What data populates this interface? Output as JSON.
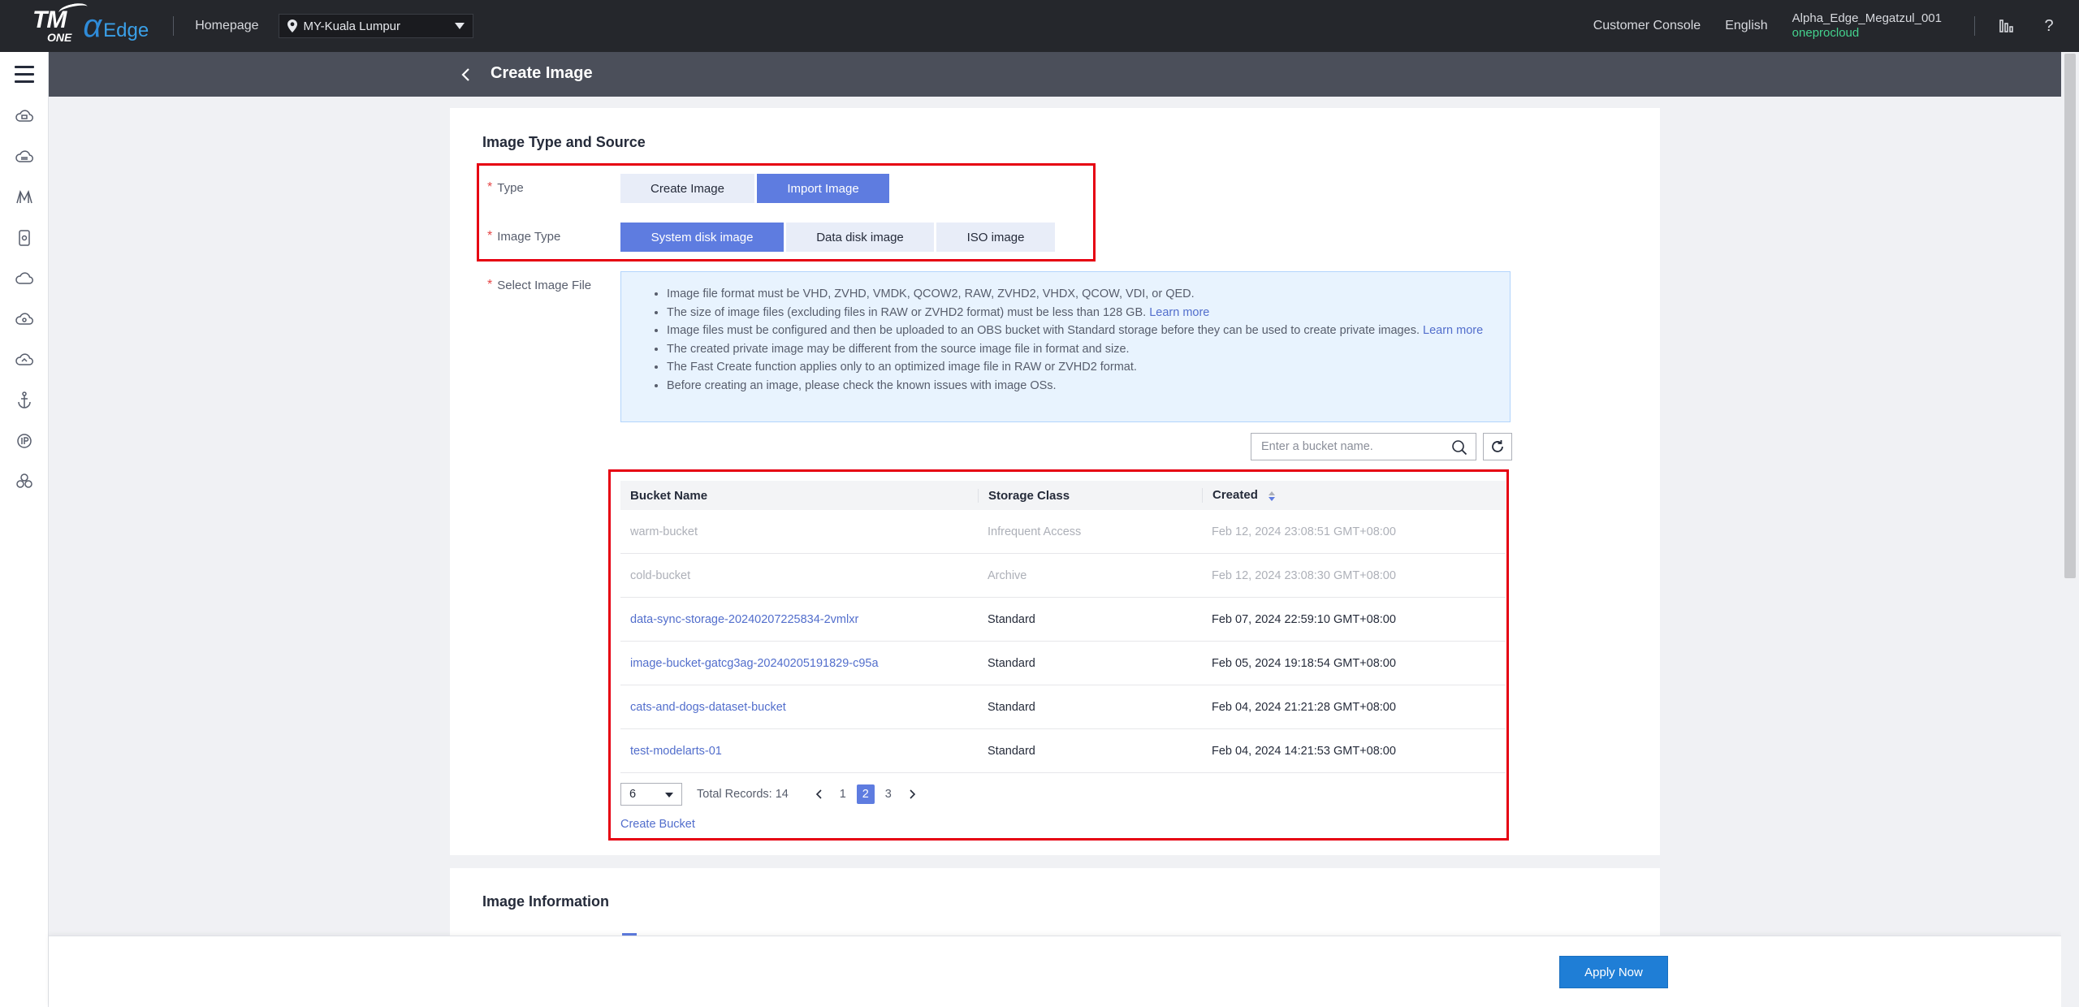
{
  "topbar": {
    "logo_tm": "TM",
    "logo_one": "ONE",
    "logo_alpha": "α",
    "logo_edge": "Edge",
    "homepage": "Homepage",
    "region": "MY-Kuala Lumpur",
    "customer_console": "Customer Console",
    "language": "English",
    "user_name": "Alpha_Edge_Megatzul_001",
    "user_org": "oneprocloud",
    "help": "?"
  },
  "header": {
    "title": "Create Image"
  },
  "image_type_section": {
    "title": "Image Type and Source",
    "type_label": "Type",
    "type_options": [
      "Create Image",
      "Import Image"
    ],
    "type_selected": "Import Image",
    "image_type_label": "Image Type",
    "image_type_options": [
      "System disk image",
      "Data disk image",
      "ISO image"
    ],
    "image_type_selected": "System disk image",
    "select_file_label": "Select Image File",
    "info": {
      "line1": "Image file format must be VHD, ZVHD, VMDK, QCOW2, RAW, ZVHD2, VHDX, QCOW, VDI, or QED.",
      "line2": "The size of image files (excluding files in RAW or ZVHD2 format) must be less than 128 GB.",
      "line2_link": "Learn more",
      "line3": "Image files must be configured and then be uploaded to an OBS bucket with Standard storage before they can be used to create private images.",
      "line3_link": "Learn more",
      "line4": "The created private image may be different from the source image file in format and size.",
      "line5": "The Fast Create function applies only to an optimized image file in RAW or ZVHD2 format.",
      "line6": "Before creating an image, please check the known issues with image OSs."
    },
    "search_placeholder": "Enter a bucket name."
  },
  "bucket_table": {
    "headers": {
      "name": "Bucket Name",
      "storage": "Storage Class",
      "created": "Created"
    },
    "rows": [
      {
        "name": "warm-bucket",
        "storage": "Infrequent Access",
        "created": "Feb 12, 2024 23:08:51 GMT+08:00"
      },
      {
        "name": "cold-bucket",
        "storage": "Archive",
        "created": "Feb 12, 2024 23:08:30 GMT+08:00"
      },
      {
        "name": "data-sync-storage-20240207225834-2vmlxr",
        "storage": "Standard",
        "created": "Feb 07, 2024 22:59:10 GMT+08:00"
      },
      {
        "name": "image-bucket-gatcg3ag-20240205191829-c95a",
        "storage": "Standard",
        "created": "Feb 05, 2024 19:18:54 GMT+08:00"
      },
      {
        "name": "cats-and-dogs-dataset-bucket",
        "storage": "Standard",
        "created": "Feb 04, 2024 21:21:28 GMT+08:00"
      },
      {
        "name": "test-modelarts-01",
        "storage": "Standard",
        "created": "Feb 04, 2024 14:21:53 GMT+08:00"
      }
    ]
  },
  "pagination": {
    "page_size": "6",
    "total": "Total Records: 14",
    "pages": [
      "1",
      "2",
      "3"
    ],
    "current": "2"
  },
  "create_bucket": "Create Bucket",
  "image_info_section": {
    "title": "Image Information"
  },
  "footer": {
    "apply": "Apply Now"
  },
  "colors": {
    "primary": "#5e7ce0",
    "link": "#526ecc",
    "apply_button": "#1f7ed6",
    "highlight_box": "#e60012",
    "topbar": "#25272c",
    "subheader": "#4b4f5a"
  }
}
